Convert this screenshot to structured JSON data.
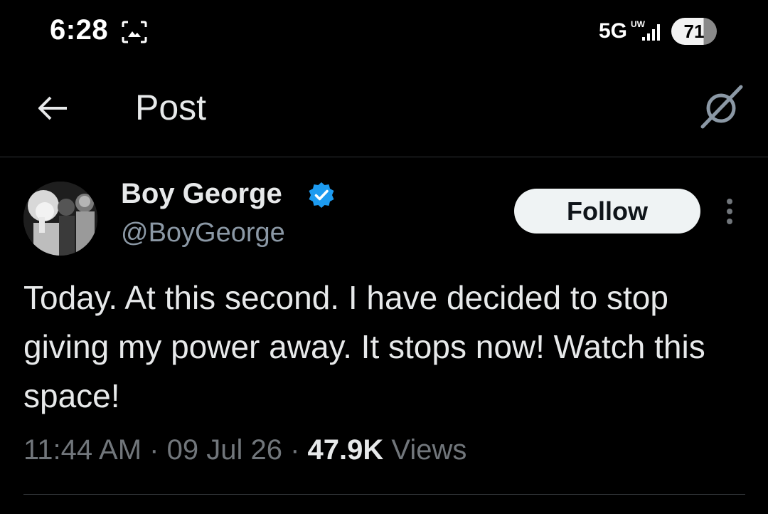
{
  "status_bar": {
    "time": "6:28",
    "network": "5G",
    "network_sub": "UW",
    "battery": "71"
  },
  "header": {
    "title": "Post"
  },
  "post": {
    "display_name": "Boy George",
    "handle": "@BoyGeorge",
    "follow_label": "Follow",
    "text": "Today. At this second. I have decided to stop giving my power away. It stops now! Watch this space!",
    "time": "11:44 AM",
    "date": "09 Jul 26",
    "separator": "·",
    "views_count": "47.9K",
    "views_label": "Views"
  },
  "colors": {
    "background": "#000000",
    "text_primary": "#e7e9ea",
    "text_secondary": "#71767b",
    "verified": "#1d9bf0",
    "follow_bg": "#eff3f4",
    "divider": "#2f3336"
  },
  "icons": {
    "back": "arrow-left-icon",
    "grok": "grok-icon",
    "verified": "verified-badge-icon",
    "more": "more-vertical-icon",
    "screenshot": "screenshot-icon",
    "signal": "signal-bars-icon"
  }
}
